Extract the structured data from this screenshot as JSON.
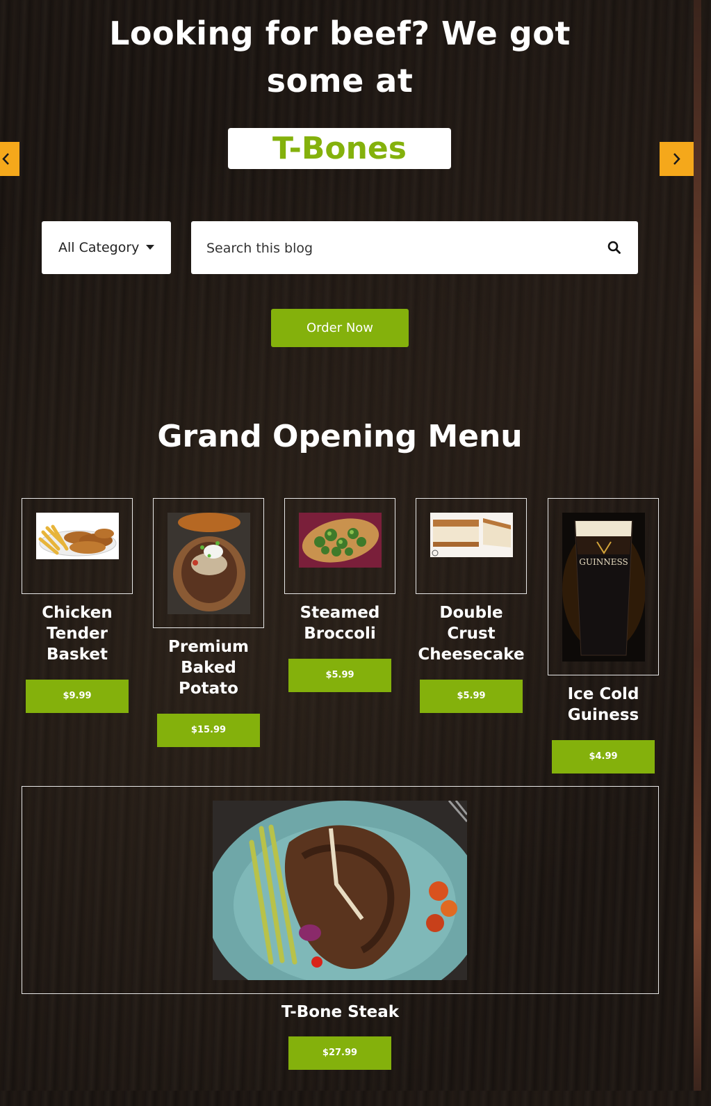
{
  "hero": {
    "title": "Looking for beef? We got some at",
    "brand": "T-Bones"
  },
  "carousel": {
    "prev_icon": "chevron-left-icon",
    "next_icon": "chevron-right-icon"
  },
  "search": {
    "category_label": "All Category",
    "placeholder": "Search this blog",
    "icon": "search-icon"
  },
  "order_button": {
    "label": "Order Now"
  },
  "menu": {
    "title": "Grand Opening Menu",
    "items": [
      {
        "name": "Chicken Tender Basket",
        "price": "$9.99"
      },
      {
        "name": "Premium Baked Potato",
        "price": "$15.99"
      },
      {
        "name": "Steamed Broccoli",
        "price": "$5.99"
      },
      {
        "name": "Double Crust Cheesecake",
        "price": "$5.99"
      },
      {
        "name": "Ice Cold Guiness",
        "price": "$4.99"
      }
    ],
    "featured": {
      "name": "T-Bone Steak",
      "price": "$27.99"
    },
    "guinness_logo": "GUINNESS"
  },
  "colors": {
    "accent": "#84b10c",
    "arrow": "#f5a81b",
    "background": "#1c1713"
  }
}
